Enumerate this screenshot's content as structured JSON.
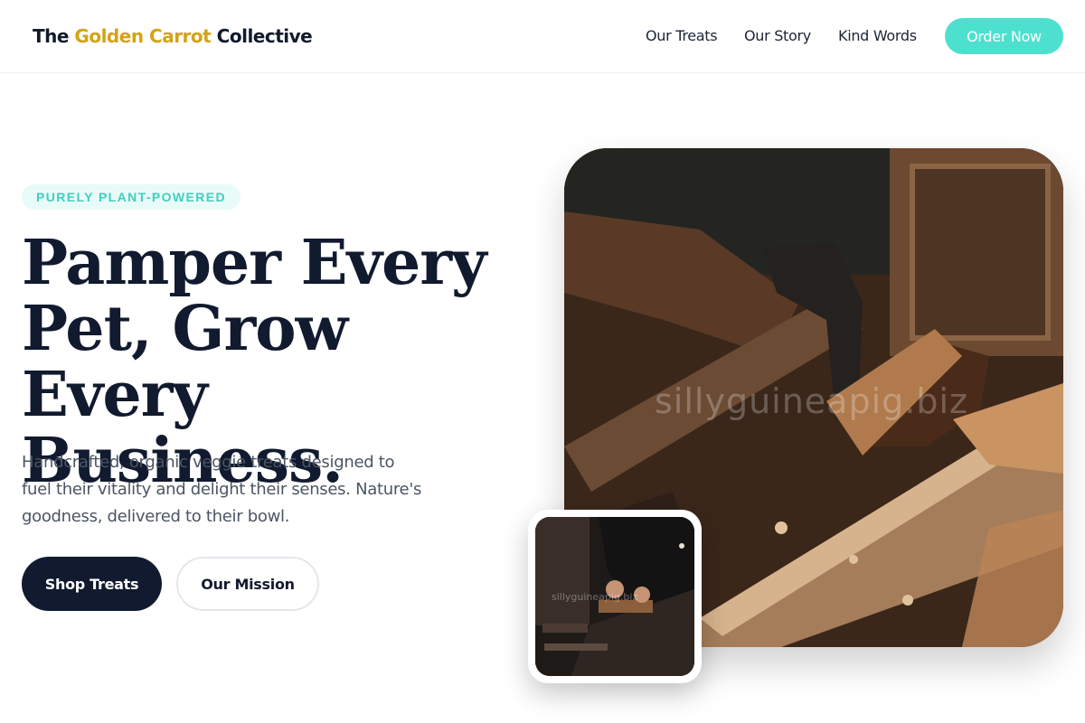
{
  "header": {
    "brand_prefix": "The ",
    "brand_accent": "Golden Carrot",
    "brand_suffix": " Collective",
    "nav": [
      {
        "label": "Our Treats"
      },
      {
        "label": "Our Story"
      },
      {
        "label": "Kind Words"
      }
    ],
    "cta_label": "Order Now"
  },
  "hero": {
    "tag": "PURELY PLANT-POWERED",
    "title": "Pamper Every Pet, Grow Every Business.",
    "description": "Handcrafted, organic veggie treats designed to fuel their vitality and delight their senses. Nature's goodness, delivered to their bowl.",
    "primary_button": "Shop Treats",
    "secondary_button": "Our Mission"
  },
  "images": {
    "main_watermark": "sillyguineapig.biz",
    "inset_watermark": "sillyguineapig.biz"
  },
  "colors": {
    "accent_gold": "#d4a317",
    "accent_teal": "#4ee0cf",
    "navy": "#111a2e"
  }
}
